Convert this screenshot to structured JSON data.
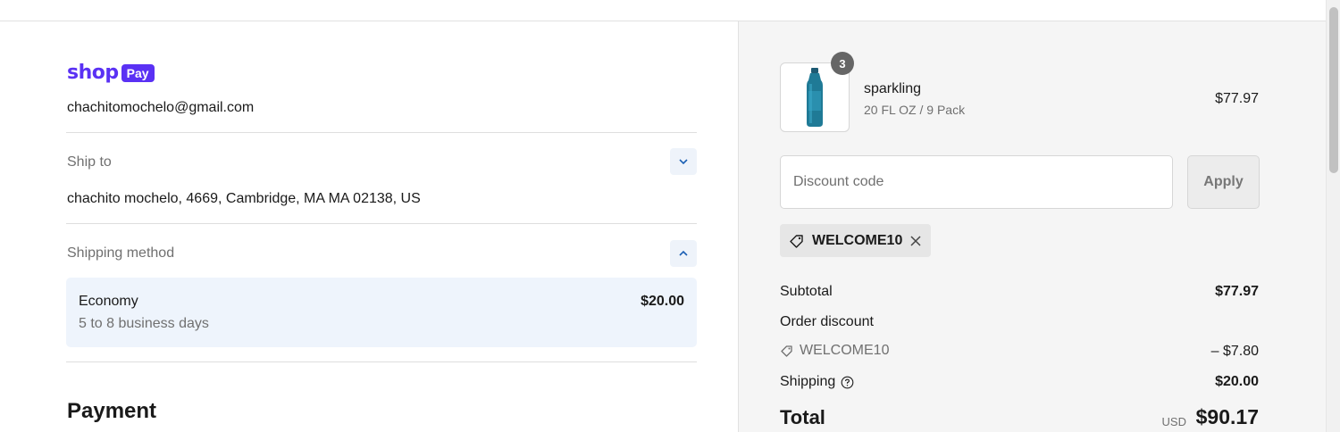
{
  "brand": {
    "shop_word": "shop",
    "pay_badge": "Pay",
    "accent_color": "#5a31f4"
  },
  "contact": {
    "email": "chachitomochelo@gmail.com"
  },
  "ship_to": {
    "label": "Ship to",
    "address": "chachito mochelo, 4669, Cambridge, MA MA 02138, US",
    "toggle_icon": "chevron-down-icon"
  },
  "shipping_method": {
    "label": "Shipping method",
    "toggle_icon": "chevron-up-icon",
    "selected": {
      "name": "Economy",
      "days": "5 to 8 business days",
      "price": "$20.00"
    }
  },
  "payment": {
    "heading": "Payment"
  },
  "order": {
    "item": {
      "name": "sparkling",
      "variant": "20 FL OZ / 9 Pack",
      "price": "$77.97",
      "quantity": "3",
      "image_icon": "water-bottle-icon"
    },
    "discount": {
      "placeholder": "Discount code",
      "value": "",
      "apply_label": "Apply",
      "applied_code": "WELCOME10"
    },
    "summary": {
      "subtotal_label": "Subtotal",
      "subtotal_value": "$77.97",
      "order_discount_label": "Order discount",
      "discount_code": "WELCOME10",
      "discount_value": "– $7.80",
      "shipping_label": "Shipping",
      "shipping_value": "$20.00",
      "total_label": "Total",
      "currency": "USD",
      "total_value": "$90.17"
    }
  }
}
